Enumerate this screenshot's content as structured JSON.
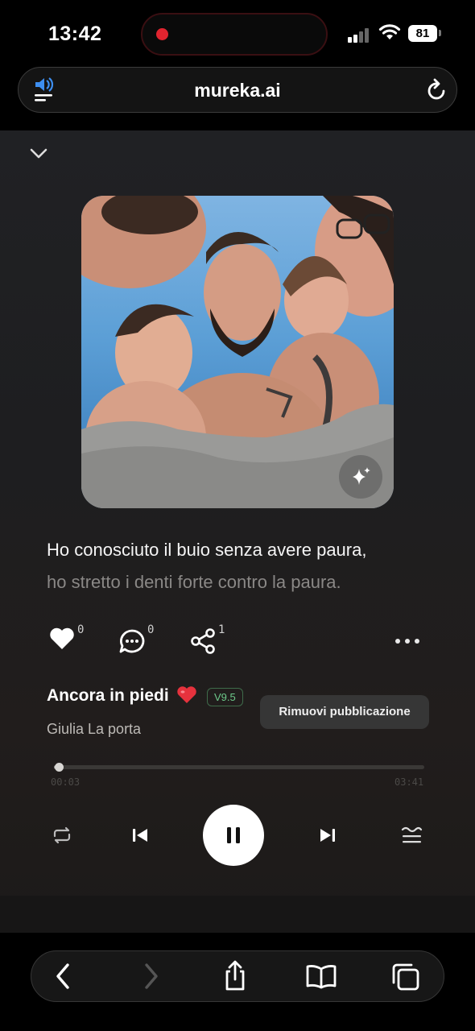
{
  "status_bar": {
    "time": "13:42",
    "battery": "81"
  },
  "browser": {
    "url": "mureka.ai"
  },
  "lyrics": {
    "current": "Ho conosciuto il buio senza avere paura,",
    "next": "ho stretto i denti forte contro la paura."
  },
  "actions": {
    "likes": "0",
    "comments": "0",
    "shares": "1"
  },
  "song": {
    "title": "Ancora in piedi",
    "emoji": "❤️",
    "version": "V9.5",
    "artist": "Giulia La porta"
  },
  "menu": {
    "remove_publication": "Rimuovi pubblicazione"
  },
  "player": {
    "current_time": "00:03",
    "total_time": "03:41",
    "progress": 0.014
  },
  "colors": {
    "accent_version": "#6dc98a",
    "recording_dot": "#e0242f",
    "speaker_blue": "#3d8ef0"
  }
}
